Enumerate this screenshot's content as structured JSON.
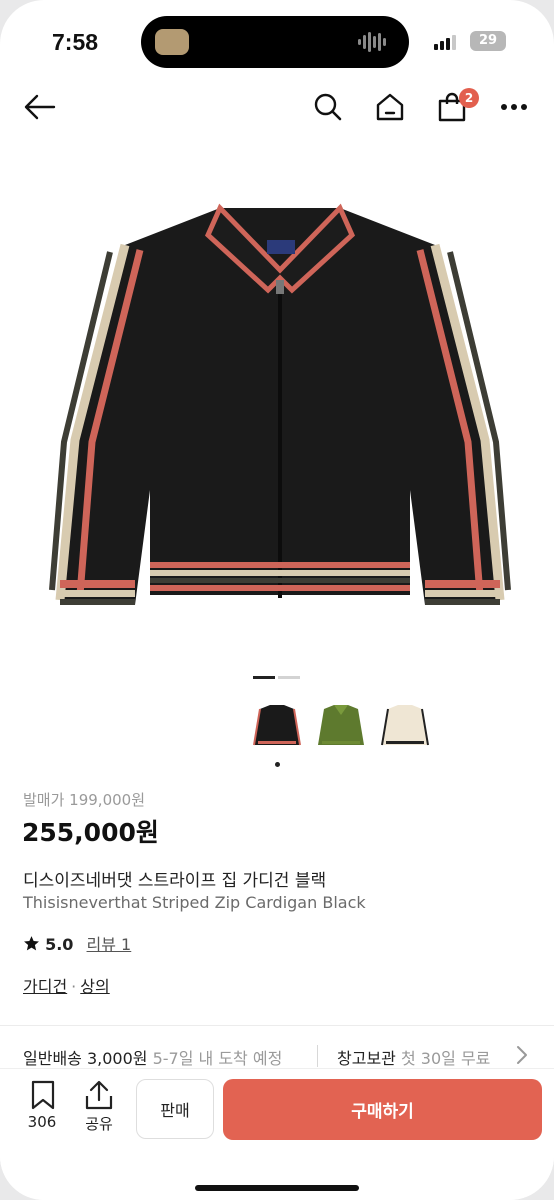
{
  "status": {
    "time": "7:58",
    "battery": "29"
  },
  "nav": {
    "cart_count": "2"
  },
  "product": {
    "original_price": "발매가 199,000원",
    "price": "255,000원",
    "name_ko": "디스이즈네버댓 스트라이프 집 가디건 블랙",
    "name_en": "Thisisneverthat Striped Zip Cardigan Black",
    "rating": "5.0",
    "reviews": "리뷰 1",
    "category_1": "가디건",
    "category_sep": "·",
    "category_2": "상의"
  },
  "variants": [
    {
      "name": "black"
    },
    {
      "name": "olive"
    },
    {
      "name": "ivory"
    }
  ],
  "shipping": {
    "label": "일반배송 3,000원",
    "eta": "5-7일 내 도착 예정",
    "storage_label": "창고보관",
    "storage_note": "첫 30일 무료"
  },
  "bottom": {
    "bookmark_count": "306",
    "share_label": "공유",
    "sell_label": "판매",
    "buy_label": "구매하기"
  },
  "colors": {
    "accent": "#e26352",
    "badge": "#e25f4e"
  }
}
